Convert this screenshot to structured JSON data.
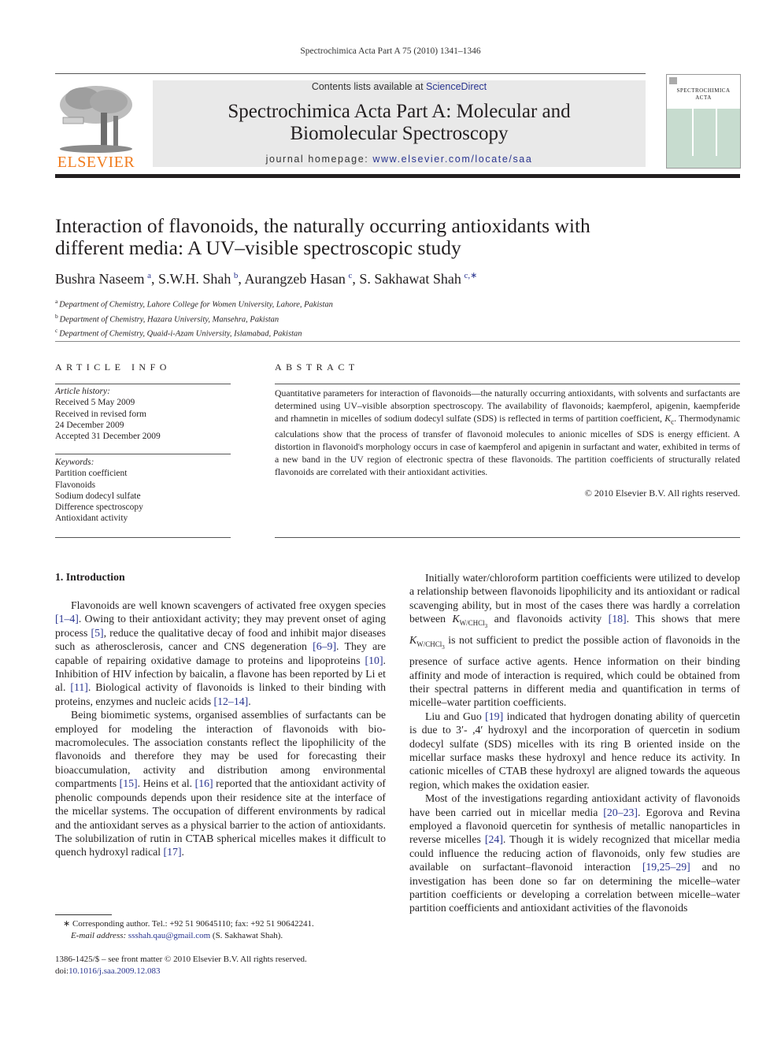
{
  "running_head": "Spectrochimica Acta Part A 75 (2010) 1341–1346",
  "header": {
    "publisher_logo": "ELSEVIER",
    "contents_prefix": "Contents lists available at ",
    "contents_link": "ScienceDirect",
    "journal_title_line1": "Spectrochimica Acta Part A: Molecular and",
    "journal_title_line2": "Biomolecular Spectroscopy",
    "homepage_prefix": "journal homepage: ",
    "homepage_link": "www.elsevier.com/locate/saa",
    "cover_title_line1": "SPECTROCHIMICA",
    "cover_title_line2": "ACTA"
  },
  "article": {
    "title_line1": "Interaction of flavonoids, the naturally occurring antioxidants with",
    "title_line2": "different media: A UV–visible spectroscopic study",
    "authors": [
      {
        "name": "Bushra Naseem",
        "sup": "a"
      },
      {
        "name": "S.W.H. Shah",
        "sup": "b"
      },
      {
        "name": "Aurangzeb Hasan",
        "sup": "c"
      },
      {
        "name": "S. Sakhawat Shah",
        "sup": "c,∗"
      }
    ],
    "affiliations": [
      {
        "sup": "a",
        "text": "Department of Chemistry, Lahore College for Women University, Lahore, Pakistan"
      },
      {
        "sup": "b",
        "text": "Department of Chemistry, Hazara University, Mansehra, Pakistan"
      },
      {
        "sup": "c",
        "text": "Department of Chemistry, Quaid-i-Azam University, Islamabad, Pakistan"
      }
    ]
  },
  "article_info": {
    "heading": "ARTICLE INFO",
    "history_label": "Article history:",
    "history": [
      "Received 5 May 2009",
      "Received in revised form",
      "24 December 2009",
      "Accepted 31 December 2009"
    ],
    "keywords_label": "Keywords:",
    "keywords": [
      "Partition coefficient",
      "Flavonoids",
      "Sodium dodecyl sulfate",
      "Difference spectroscopy",
      "Antioxidant activity"
    ]
  },
  "abstract": {
    "heading": "ABSTRACT",
    "text_before_k": "Quantitative parameters for interaction of flavonoids—the naturally occurring antioxidants, with solvents and surfactants are determined using UV–visible absorption spectroscopy. The availability of flavonoids; kaempferol, apigenin, kaempferide and rhamnetin in micelles of sodium dodecyl sulfate (SDS) is reflected in terms of partition coefficient, ",
    "k_symbol": "K",
    "k_sub": "c",
    "text_after_k": ". Thermodynamic calculations show that the process of transfer of flavonoid molecules to anionic micelles of SDS is energy efficient. A distortion in flavonoid's morphology occurs in case of kaempferol and apigenin in surfactant and water, exhibited in terms of a new band in the UV region of electronic spectra of these flavonoids. The partition coefficients of structurally related flavonoids are correlated with their antioxidant activities.",
    "copyright": "© 2010 Elsevier B.V. All rights reserved."
  },
  "intro": {
    "heading": "1.  Introduction",
    "p1": [
      {
        "t": "Flavonoids are well known scavengers of activated free oxygen species "
      },
      {
        "ref": "[1–4]"
      },
      {
        "t": ". Owing to their antioxidant activity; they may prevent onset of aging process "
      },
      {
        "ref": "[5]"
      },
      {
        "t": ", reduce the qualitative decay of food and inhibit major diseases such as atherosclerosis, cancer and CNS degeneration "
      },
      {
        "ref": "[6–9]"
      },
      {
        "t": ". They are capable of repairing oxidative damage to proteins and lipoproteins "
      },
      {
        "ref": "[10]"
      },
      {
        "t": ". Inhibition of HIV infection by baicalin, a flavone has been reported by Li et al. "
      },
      {
        "ref": "[11]"
      },
      {
        "t": ". Biological activity of flavonoids is linked to their binding with proteins, enzymes and nucleic acids "
      },
      {
        "ref": "[12–14]"
      },
      {
        "t": "."
      }
    ],
    "p2": [
      {
        "t": "Being biomimetic systems, organised assemblies of surfactants can be employed for modeling the interaction of flavonoids with bio-macromolecules. The association constants reflect the lipophilicity of the flavonoids and therefore they may be used for forecasting their bioaccumulation, activity and distribution among environmental compartments "
      },
      {
        "ref": "[15]"
      },
      {
        "t": ". Heins et al. "
      },
      {
        "ref": "[16]"
      },
      {
        "t": " reported that the antioxidant activity of phenolic compounds depends upon their residence site at the interface of the micellar systems. The occupation of different environments by radical and the antioxidant serves as a physical barrier to the action of antioxidants. The solubilization of rutin in CTAB spherical micelles makes it difficult to quench hydroxyl radical "
      },
      {
        "ref": "[17]"
      },
      {
        "t": "."
      }
    ],
    "p3": [
      {
        "t": "Initially water/chloroform partition coefficients were utilized to develop a relationship between flavonoids lipophilicity and its antioxidant or radical scavenging ability, but in most of the cases there was hardly a correlation between "
      },
      {
        "k": "K",
        "sub": "W/CHCl",
        "subsub": "3"
      },
      {
        "t": " and flavonoids activity "
      },
      {
        "ref": "[18]"
      },
      {
        "t": ". This shows that mere "
      },
      {
        "k": "K",
        "sub": "W/CHCl",
        "subsub": "3"
      },
      {
        "t": " is not sufficient to predict the possible action of flavonoids in the presence of surface active agents. Hence information on their binding affinity and mode of interaction is required, which could be obtained from their spectral patterns in different media and quantification in terms of micelle–water partition coefficients."
      }
    ],
    "p4": [
      {
        "t": "Liu and Guo "
      },
      {
        "ref": "[19]"
      },
      {
        "t": " indicated that hydrogen donating ability of quercetin is due to 3′- ,4′ hydroxyl and the incorporation of quercetin in sodium dodecyl sulfate (SDS) micelles with its ring B oriented inside on the micellar surface masks these hydroxyl and hence reduce its activity. In cationic micelles of CTAB these hydroxyl are aligned towards the aqueous region, which makes the oxidation easier."
      }
    ],
    "p5": [
      {
        "t": "Most of the investigations regarding antioxidant activity of flavonoids have been carried out in micellar media "
      },
      {
        "ref": "[20–23]"
      },
      {
        "t": ". Egorova and Revina employed a flavonoid quercetin for synthesis of metallic nanoparticles in reverse micelles "
      },
      {
        "ref": "[24]"
      },
      {
        "t": ". Though it is widely recognized that micellar media could influence the reducing action of flavonoids, only few studies are available on surfactant–flavonoid interaction "
      },
      {
        "ref": "[19,25–29]"
      },
      {
        "t": " and no investigation has been done so far on determining the micelle–water partition coefficients or developing a correlation between micelle–water partition coefficients and antioxidant activities of the flavonoids"
      }
    ]
  },
  "footnote": {
    "star_line": "∗ Corresponding author. Tel.: +92 51 90645110; fax: +92 51 90642241.",
    "email_label": "E-mail address: ",
    "email": "ssshah.qau@gmail.com",
    "email_suffix": " (S. Sakhawat Shah)."
  },
  "front_matter": {
    "issn_line": "1386-1425/$ – see front matter © 2010 Elsevier B.V. All rights reserved.",
    "doi_prefix": "doi:",
    "doi": "10.1016/j.saa.2009.12.083"
  },
  "colors": {
    "link": "#2a3590",
    "elsevier_orange": "#f07c1e",
    "banner_grey": "#e9e9e9",
    "cover_green": "#c7dccf"
  }
}
